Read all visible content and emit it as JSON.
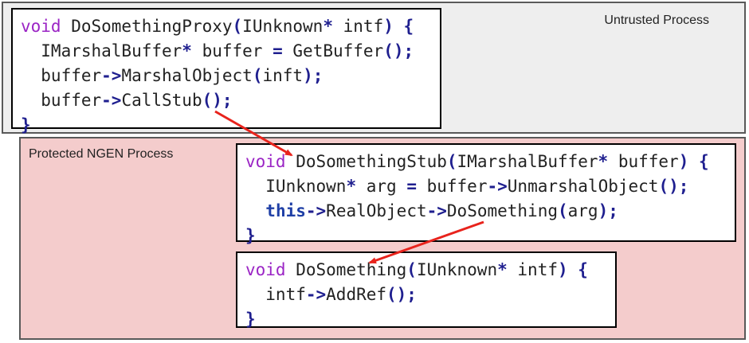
{
  "untrusted": {
    "label": "Untrusted Process"
  },
  "protected": {
    "label": "Protected NGEN Process"
  },
  "proxy": {
    "lines": [
      [
        {
          "t": "void",
          "c": "kw"
        },
        {
          "t": " DoSomethingProxy"
        },
        {
          "t": "(",
          "c": "p"
        },
        {
          "t": "IUnknown"
        },
        {
          "t": "*",
          "c": "p"
        },
        {
          "t": " intf"
        },
        {
          "t": ")",
          "c": "p"
        },
        {
          "t": " "
        },
        {
          "t": "{",
          "c": "p"
        }
      ],
      [
        {
          "t": "  IMarshalBuffer"
        },
        {
          "t": "*",
          "c": "p"
        },
        {
          "t": " buffer "
        },
        {
          "t": "=",
          "c": "p"
        },
        {
          "t": " GetBuffer"
        },
        {
          "t": "();",
          "c": "p"
        }
      ],
      [
        {
          "t": "  buffer"
        },
        {
          "t": "->",
          "c": "p"
        },
        {
          "t": "MarshalObject"
        },
        {
          "t": "(",
          "c": "p"
        },
        {
          "t": "inft"
        },
        {
          "t": ");",
          "c": "p"
        }
      ],
      [
        {
          "t": "  buffer"
        },
        {
          "t": "->",
          "c": "p"
        },
        {
          "t": "CallStub"
        },
        {
          "t": "();",
          "c": "p"
        }
      ],
      [
        {
          "t": "}",
          "c": "p"
        }
      ]
    ]
  },
  "stub": {
    "lines": [
      [
        {
          "t": "void",
          "c": "kw"
        },
        {
          "t": " DoSomethingStub"
        },
        {
          "t": "(",
          "c": "p"
        },
        {
          "t": "IMarshalBuffer"
        },
        {
          "t": "*",
          "c": "p"
        },
        {
          "t": " buffer"
        },
        {
          "t": ")",
          "c": "p"
        },
        {
          "t": " "
        },
        {
          "t": "{",
          "c": "p"
        }
      ],
      [
        {
          "t": "  IUnknown"
        },
        {
          "t": "*",
          "c": "p"
        },
        {
          "t": " arg "
        },
        {
          "t": "=",
          "c": "p"
        },
        {
          "t": " buffer"
        },
        {
          "t": "->",
          "c": "p"
        },
        {
          "t": "UnmarshalObject"
        },
        {
          "t": "();",
          "c": "p"
        }
      ],
      [
        {
          "t": "  "
        },
        {
          "t": "this",
          "c": "this-kw"
        },
        {
          "t": "->",
          "c": "p"
        },
        {
          "t": "RealObject"
        },
        {
          "t": "->",
          "c": "p"
        },
        {
          "t": "DoSomething"
        },
        {
          "t": "(",
          "c": "p"
        },
        {
          "t": "arg"
        },
        {
          "t": ");",
          "c": "p"
        }
      ],
      [
        {
          "t": "}",
          "c": "p"
        }
      ]
    ]
  },
  "impl": {
    "lines": [
      [
        {
          "t": "void",
          "c": "kw"
        },
        {
          "t": " DoSomething"
        },
        {
          "t": "(",
          "c": "p"
        },
        {
          "t": "IUnknown"
        },
        {
          "t": "*",
          "c": "p"
        },
        {
          "t": " intf"
        },
        {
          "t": ")",
          "c": "p"
        },
        {
          "t": " "
        },
        {
          "t": "{",
          "c": "p"
        }
      ],
      [
        {
          "t": "  intf"
        },
        {
          "t": "->",
          "c": "p"
        },
        {
          "t": "AddRef"
        },
        {
          "t": "();",
          "c": "p"
        }
      ],
      [
        {
          "t": "}",
          "c": "p"
        }
      ]
    ]
  },
  "colors": {
    "arrow": "#e8231c",
    "protected_bg": "#f4cccc",
    "untrusted_bg": "#eeeeee",
    "keyword": "#9b25c5"
  }
}
